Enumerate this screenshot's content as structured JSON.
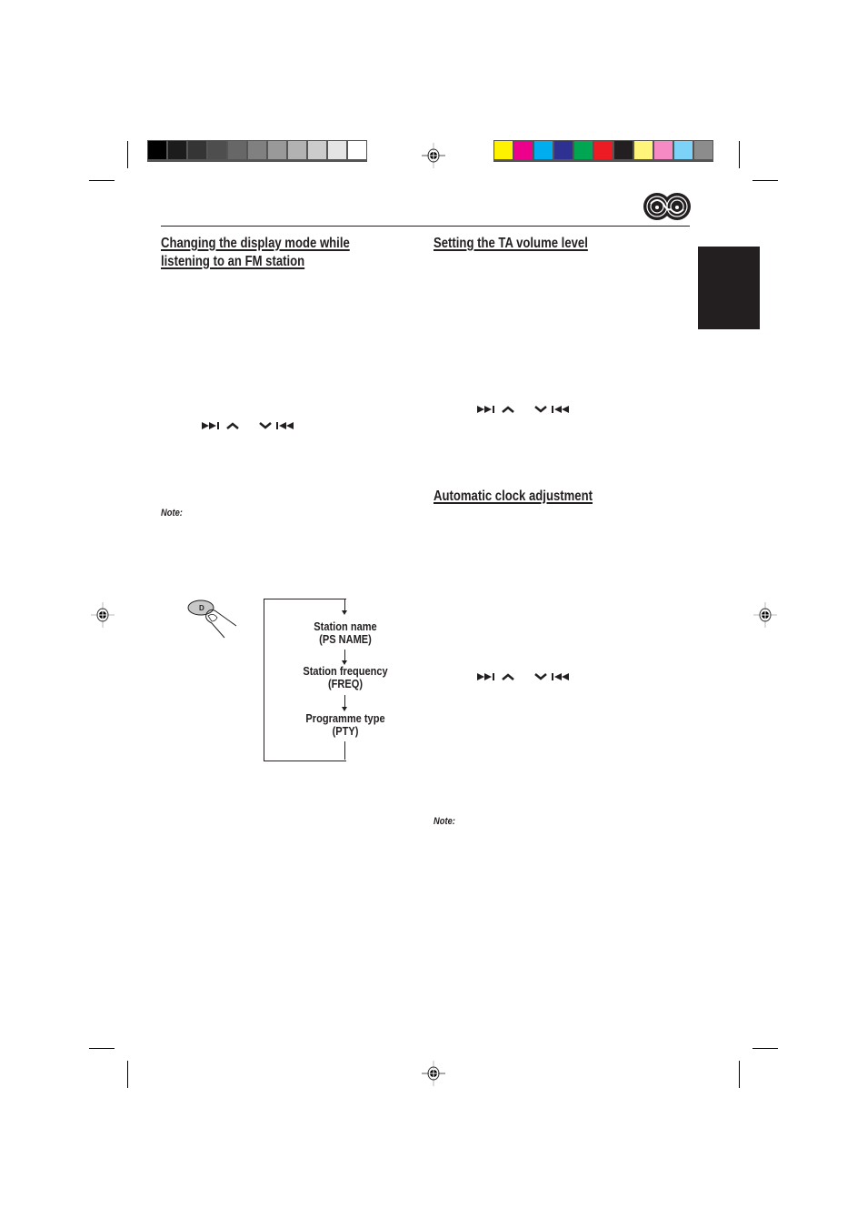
{
  "color_bars": {
    "grayscale": [
      "#000000",
      "#1c1c1c",
      "#353535",
      "#4e4e4e",
      "#676767",
      "#808080",
      "#999999",
      "#b2b2b2",
      "#cccccc",
      "#e5e5e5",
      "#ffffff"
    ],
    "process": [
      "#fff200",
      "#ec008c",
      "#00aeef",
      "#2e3192",
      "#00a651",
      "#ed1c24",
      "#231f20",
      "#fff57a",
      "#f58ac5",
      "#7dd3f7",
      "#8c8c8c"
    ]
  },
  "left_column": {
    "heading_line1": "Changing the display mode while",
    "heading_line2": "listening to an FM station",
    "buttons": {
      "next": "▶▶|",
      "up": "︿",
      "down": "﹀",
      "prev": "|◀◀"
    },
    "note_label": "Note:",
    "diagram": {
      "button_label": "D",
      "steps": [
        {
          "line1": "Station name",
          "line2": "(PS NAME)"
        },
        {
          "line1": "Station frequency",
          "line2": "(FREQ)"
        },
        {
          "line1": "Programme type",
          "line2": "(PTY)"
        }
      ]
    }
  },
  "right_column": {
    "section1_heading": "Setting the TA volume level",
    "section2_heading": "Automatic clock adjustment",
    "note_label": "Note:"
  },
  "icons": {
    "logo": "disc-logo-icon",
    "registration": "registration-mark-icon"
  }
}
